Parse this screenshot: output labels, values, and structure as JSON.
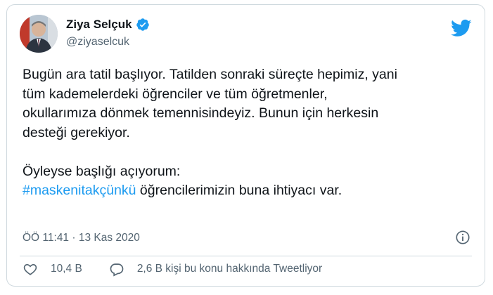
{
  "user": {
    "display_name": "Ziya Selçuk",
    "handle": "@ziyaselcuk"
  },
  "tweet": {
    "lines": [
      "Bugün ara tatil başlıyor. Tatilden sonraki süreçte hepimiz, yani",
      "tüm kademelerdeki öğrenciler ve tüm öğretmenler,",
      "okullarımıza dönmek temennisindeyiz. Bunun için herkesin",
      "desteği gerekiyor.",
      "Öyleyse başlığı açıyorum:"
    ],
    "hashtag": "#maskenitakçünkü",
    "hashtag_suffix": " öğrencilerimizin buna ihtiyacı var.",
    "timestamp": "ÖÖ 11:41 · 13 Kas 2020"
  },
  "actions": {
    "likes": "10,4 B",
    "replies": "2,6 B kişi bu konu hakkında Tweetliyor"
  },
  "colors": {
    "accent": "#1d9bf0",
    "text": "#0f1419",
    "secondary": "#536471",
    "border": "#cfd9de"
  },
  "icons": [
    "verified-badge-icon",
    "twitter-bird-icon",
    "info-icon",
    "heart-icon",
    "reply-icon"
  ]
}
